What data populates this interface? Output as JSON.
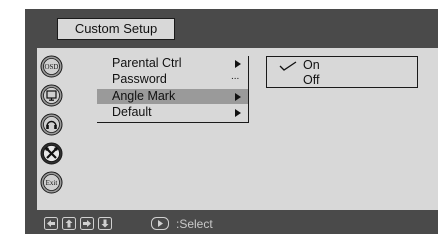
{
  "header": {
    "title": "Custom Setup"
  },
  "sidebar": {
    "icons": [
      {
        "name": "osd-icon",
        "text": "OSD",
        "active": false
      },
      {
        "name": "monitor-icon",
        "active": false
      },
      {
        "name": "speaker-icon",
        "active": false
      },
      {
        "name": "tools-icon",
        "active": true
      },
      {
        "name": "exit-icon",
        "text": "Exit",
        "active": false
      }
    ]
  },
  "menu": {
    "items": [
      {
        "label": "Parental Ctrl",
        "indicator": "arrow"
      },
      {
        "label": "Password",
        "indicator": "..."
      },
      {
        "label": "Angle Mark",
        "indicator": "arrow",
        "selected": true
      },
      {
        "label": "Default",
        "indicator": "arrow"
      }
    ]
  },
  "submenu": {
    "items": [
      {
        "label": "On",
        "checked": true
      },
      {
        "label": "Off",
        "checked": false
      }
    ]
  },
  "footer": {
    "nav_buttons": [
      "left-arrow-icon",
      "up-arrow-icon",
      "right-arrow-icon",
      "down-arrow-icon"
    ],
    "select_label": ":Select"
  },
  "colors": {
    "frame": "#4a4a4a",
    "panel": "#d8d8d8",
    "highlight": "#9a9a9a",
    "icon_active": "#2e2e2e"
  }
}
